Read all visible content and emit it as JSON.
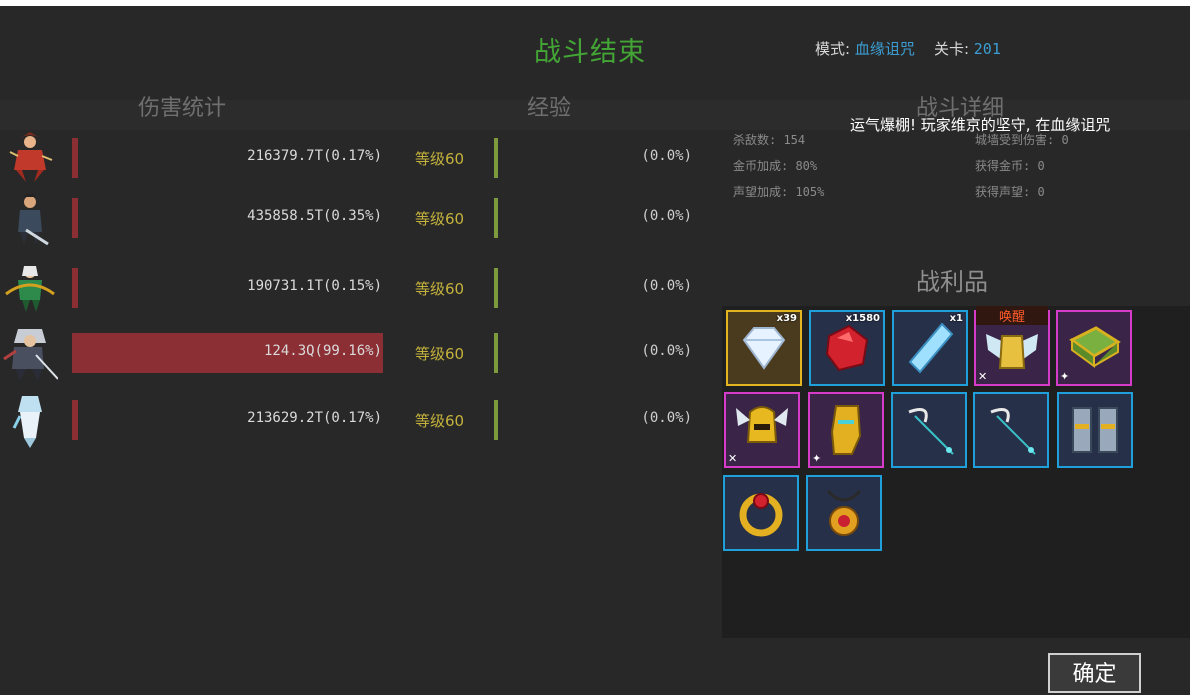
{
  "header": {
    "title": "战斗结束",
    "mode_label": "模式:",
    "mode_value": "血缘诅咒",
    "level_label": "关卡:",
    "level_value": "201"
  },
  "columns": {
    "damage": "伤害统计",
    "exp": "经验",
    "detail": "战斗详细"
  },
  "heroes": [
    {
      "damage_text": "216379.7T(0.17%)",
      "damage_share": 0.0017,
      "level_text": "等级60",
      "exp_text": "(0.0%)",
      "exp_share": 0.0,
      "icon": "hero-red-warrior-icon"
    },
    {
      "damage_text": "435858.5T(0.35%)",
      "damage_share": 0.0035,
      "level_text": "等级60",
      "exp_text": "(0.0%)",
      "exp_share": 0.0,
      "icon": "hero-swordsman-icon"
    },
    {
      "damage_text": "190731.1T(0.15%)",
      "damage_share": 0.0015,
      "level_text": "等级60",
      "exp_text": "(0.0%)",
      "exp_share": 0.0,
      "icon": "hero-archer-icon"
    },
    {
      "damage_text": "124.3Q(99.16%)",
      "damage_share": 0.9916,
      "level_text": "等级60",
      "exp_text": "(0.0%)",
      "exp_share": 0.0,
      "icon": "hero-silver-knight-icon"
    },
    {
      "damage_text": "213629.2T(0.17%)",
      "damage_share": 0.0017,
      "level_text": "等级60",
      "exp_text": "(0.0%)",
      "exp_share": 0.0,
      "icon": "hero-white-mage-icon"
    }
  ],
  "details": {
    "kills": "杀敌数: 154",
    "wall_damage": "城墙受到伤害: 0",
    "gold_bonus": "金币加成: 80%",
    "gold_gain": "获得金币: 0",
    "fame_bonus": "声望加成: 105%",
    "fame_gain": "获得声望: 0"
  },
  "scroll_message": "运气爆棚! 玩家维京的坚守, 在血缘诅咒",
  "loot": {
    "title": "战利品",
    "items": [
      {
        "icon": "diamond-icon",
        "count": "x39",
        "rarity": "gold"
      },
      {
        "icon": "red-gem-icon",
        "count": "x1580",
        "rarity": "blue"
      },
      {
        "icon": "blue-crystal-icon",
        "count": "x1",
        "rarity": "blue"
      },
      {
        "icon": "winged-armor-icon",
        "count": "",
        "awaken": "唤醒",
        "rarity": "purple"
      },
      {
        "icon": "spellbook-icon",
        "count": "",
        "rarity": "purple"
      },
      {
        "icon": "winged-helmet-icon",
        "count": "",
        "rarity": "purple"
      },
      {
        "icon": "gauntlet-icon",
        "count": "",
        "rarity": "purple"
      },
      {
        "icon": "bow-icon",
        "count": "",
        "rarity": "blue"
      },
      {
        "icon": "bow-icon",
        "count": "",
        "rarity": "blue"
      },
      {
        "icon": "greaves-icon",
        "count": "",
        "rarity": "blue"
      },
      {
        "icon": "ring-icon",
        "count": "",
        "rarity": "blue"
      },
      {
        "icon": "amulet-icon",
        "count": "",
        "rarity": "blue"
      }
    ]
  },
  "confirm_label": "确定",
  "colors": {
    "title": "#43a535",
    "damage_bar": "#8b2f35",
    "level": "#c4b23c",
    "exp_bar": "#7d9b3d",
    "link": "#3b9ed3"
  }
}
